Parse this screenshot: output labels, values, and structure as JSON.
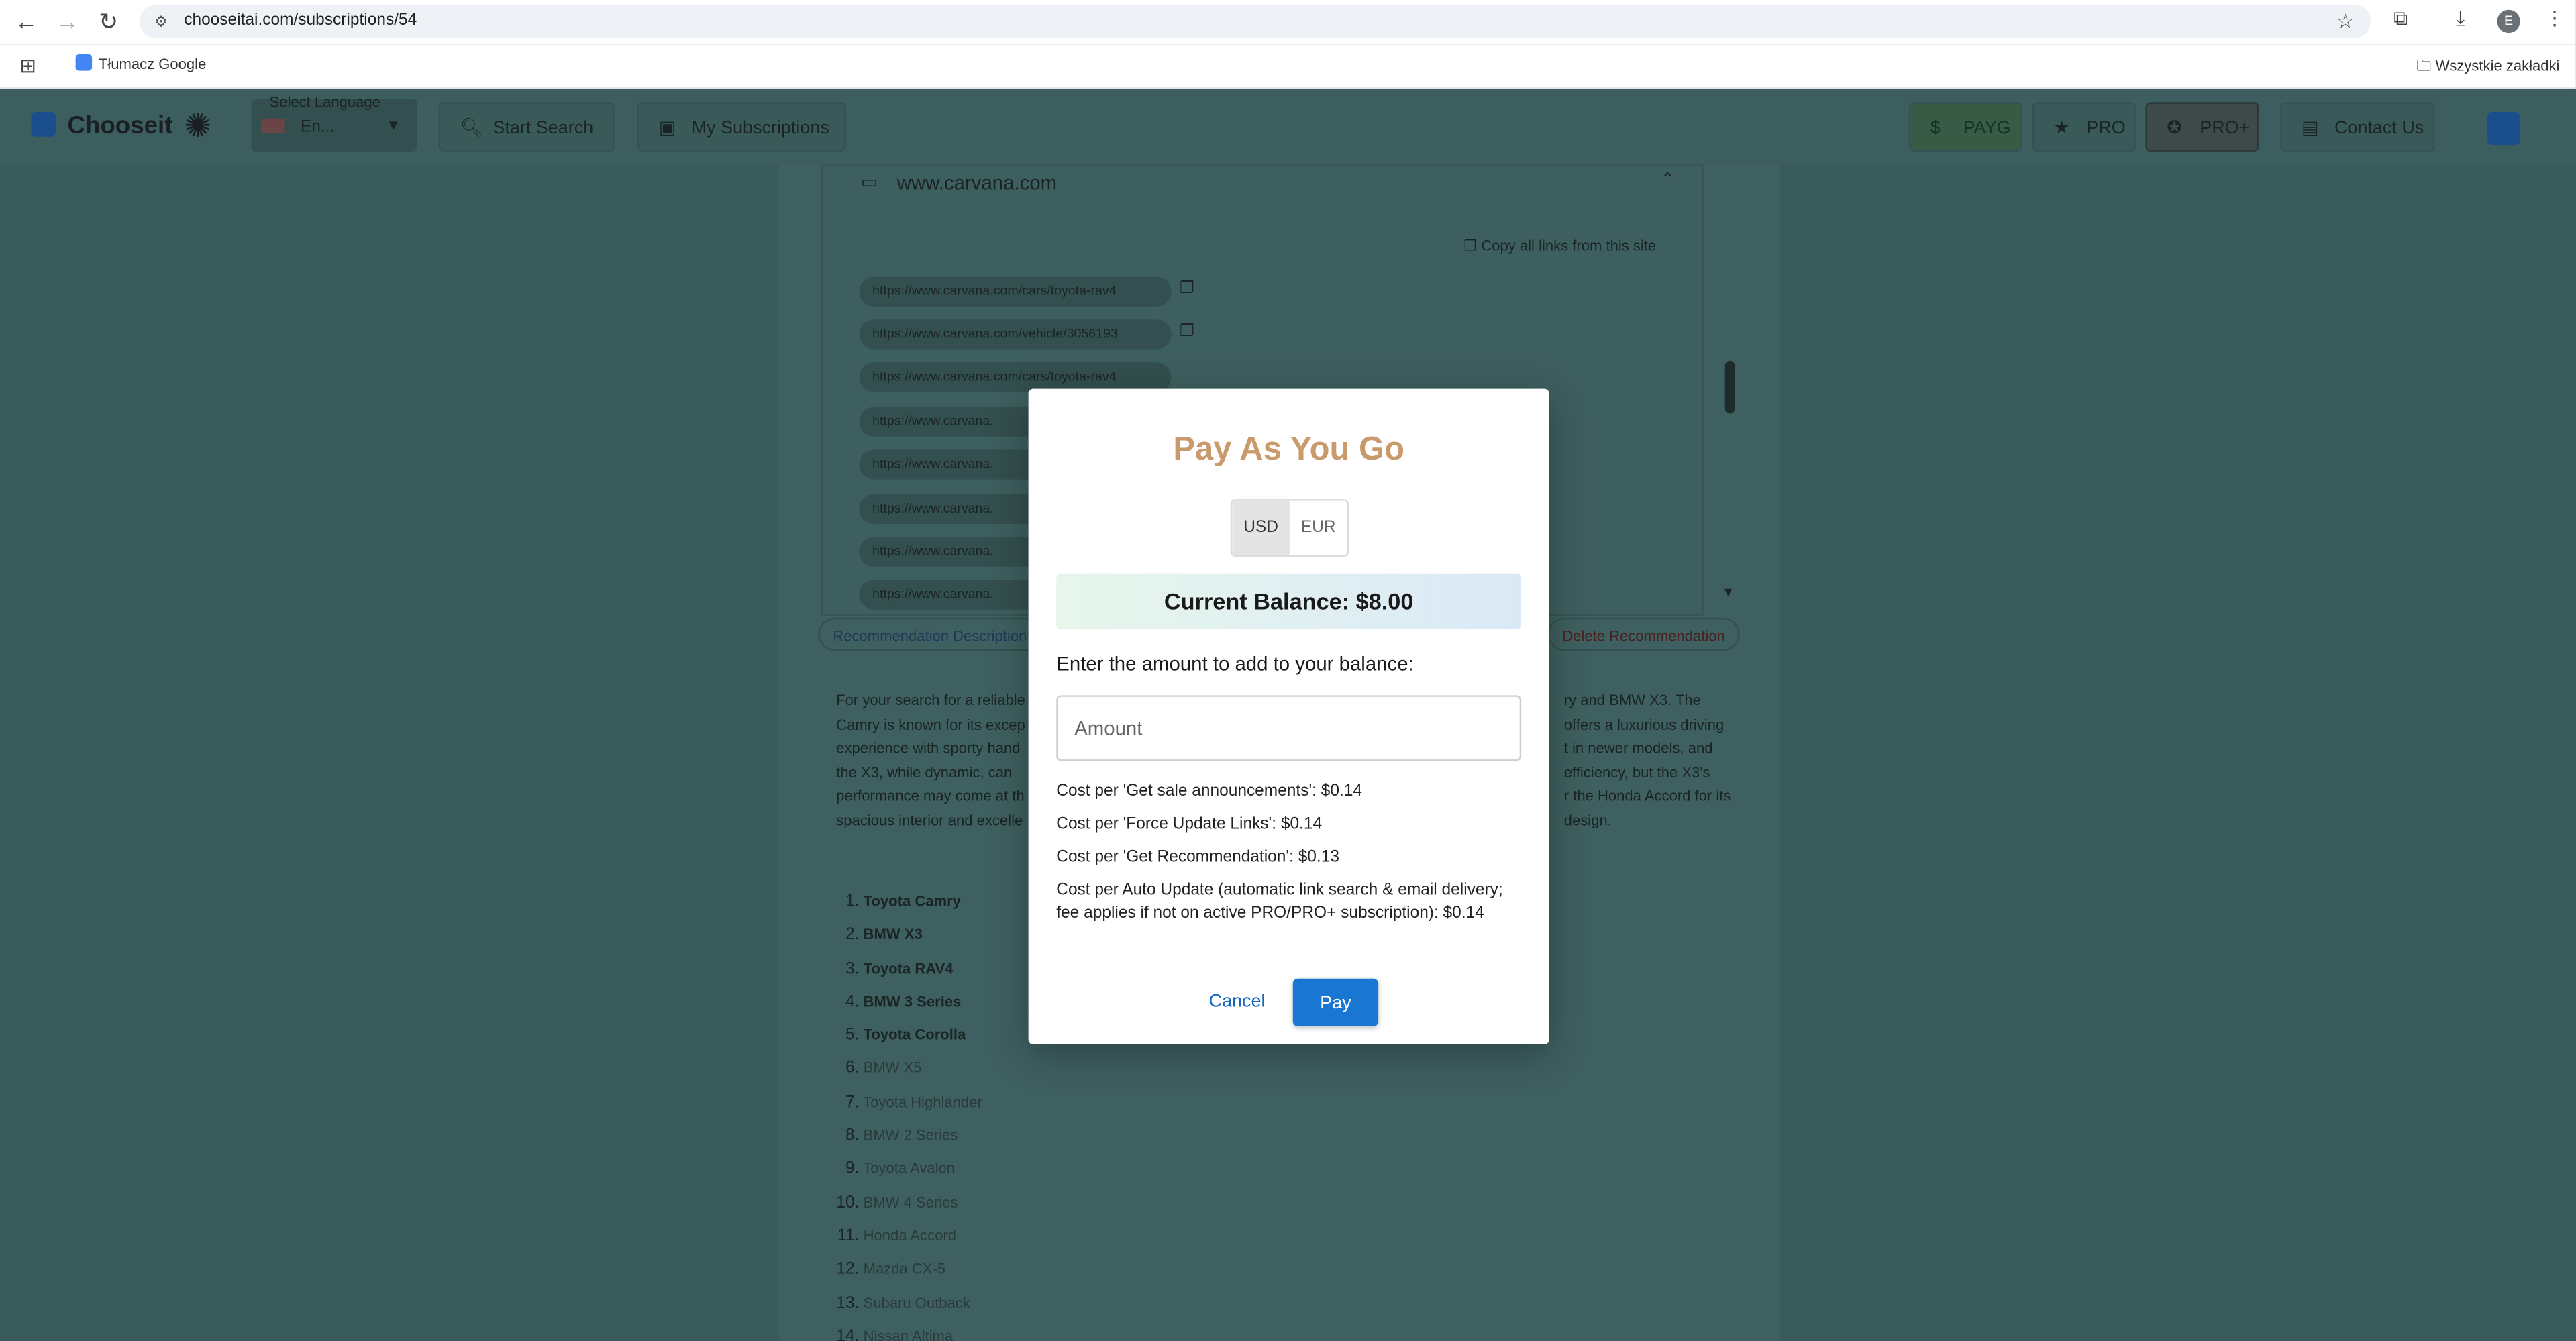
{
  "browser": {
    "url": "chooseitai.com/subscriptions/54",
    "bookmark": "Tłumacz Google",
    "bookmarks_folder": "Wszystkie zakładki",
    "profile_initial": "E"
  },
  "header": {
    "logo_text": "Chooseit",
    "language_label": "Select Language",
    "language_value": "En...",
    "start_search": "Start Search",
    "my_subscriptions": "My Subscriptions",
    "payg": "PAYG",
    "pro": "PRO",
    "proplus": "PRO+",
    "contact": "Contact Us"
  },
  "content": {
    "site": "www.carvana.com",
    "copy_all": "Copy all links from this site",
    "links": [
      "https://www.carvana.com/cars/toyota-rav4",
      "https://www.carvana.com/vehicle/3056193",
      "https://www.carvana.com/cars/toyota-rav4",
      "https://www.carvana.",
      "https://www.carvana.",
      "https://www.carvana.",
      "https://www.carvana.",
      "https://www.carvana."
    ],
    "tab_description": "Recommendation Description",
    "tab_delete": "Delete Recommendation",
    "description_left": "For your search for a reliable\nCamry is known for its excep\nexperience with sporty hand\nthe X3, while dynamic, can\nperformance may come at th\nspacious interior and excelle",
    "description_right": "ry and BMW X3. The\noffers a luxurious driving\nt in newer models, and\nefficiency, but the X3's\nr the Honda Accord for its\ndesign.",
    "recommendations": [
      "Toyota Camry",
      "BMW X3",
      "Toyota RAV4",
      "BMW 3 Series",
      "Toyota Corolla",
      "BMW X5",
      "Toyota Highlander",
      "BMW 2 Series",
      "Toyota Avalon",
      "BMW 4 Series",
      "Honda Accord",
      "Mazda CX-5",
      "Subaru Outback",
      "Nissan Altima"
    ]
  },
  "modal": {
    "title": "Pay As You Go",
    "currency_usd": "USD",
    "currency_eur": "EUR",
    "balance": "Current Balance: $8.00",
    "enter_label": "Enter the amount to add to your balance:",
    "amount_placeholder": "Amount",
    "cost_sale": "Cost per 'Get sale announcements': $0.14",
    "cost_force": "Cost per 'Force Update Links': $0.14",
    "cost_rec": "Cost per 'Get Recommendation': $0.13",
    "cost_auto": "Cost per Auto Update (automatic link search & email delivery; fee applies if not on active PRO/PRO+ subscription): $0.14",
    "cancel": "Cancel",
    "pay": "Pay"
  }
}
